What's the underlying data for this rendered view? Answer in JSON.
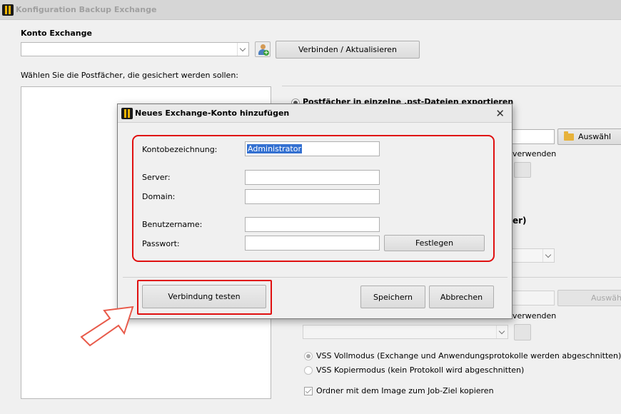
{
  "main": {
    "window_title": "Konfiguration Backup Exchange",
    "konto_heading": "Konto Exchange",
    "connect_button": "Verbinden / Aktualisieren",
    "select_mailboxes_label": "Wählen Sie die Postfächer, die gesichert werden sollen:",
    "pst_option": "Postfächer in einzelne .pst-Dateien exportieren",
    "browse_button_1": "Auswähl",
    "partial_use_1": "verwenden",
    "partial_paren": "er)",
    "browse_button_2": "Auswähl",
    "partial_use_2": "verwenden",
    "vss_full": "VSS Vollmodus (Exchange und Anwendungsprotokolle werden abgeschnitten)",
    "vss_copy": "VSS Kopiermodus (kein Protokoll wird abgeschnitten)",
    "copy_folder_checkbox": "Ordner mit dem Image zum Job-Ziel kopieren"
  },
  "dialog": {
    "title": "Neues Exchange-Konto hinzufügen",
    "close_glyph": "✕",
    "account_name_label": "Kontobezeichnung:",
    "account_name_value": "Administrator",
    "server_label": "Server:",
    "domain_label": "Domain:",
    "username_label": "Benutzername:",
    "password_label": "Passwort:",
    "set_button": "Festlegen",
    "test_button": "Verbindung testen",
    "save_button": "Speichern",
    "cancel_button": "Abbrechen"
  },
  "colors": {
    "highlight_red": "#e01010",
    "selection_blue": "#3370d1",
    "app_icon_yellow": "#f2b300"
  }
}
